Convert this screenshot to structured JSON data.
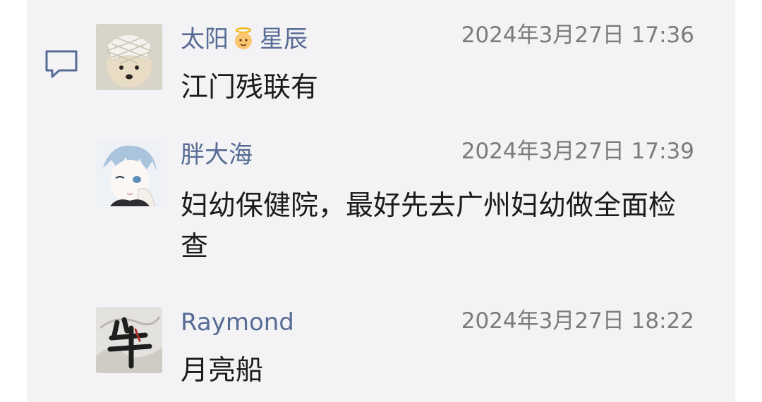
{
  "comments": [
    {
      "author": "太阳",
      "author_suffix": "星辰",
      "badge_icon": "angel-baby-emoji-icon",
      "time": "2024年3月27日 17:36",
      "text": "江门残联有"
    },
    {
      "author": "胖大海",
      "time": "2024年3月27日 17:39",
      "text": "妇幼保健院，最好先去广州妇幼做全面检查"
    },
    {
      "author": "Raymond",
      "time": "2024年3月27日 18:22",
      "text": "月亮船"
    }
  ],
  "colors": {
    "panel_bg": "#f3f3f5",
    "author_link": "#576b95",
    "timestamp": "#7b7b7b",
    "text": "#1b1b1b"
  }
}
